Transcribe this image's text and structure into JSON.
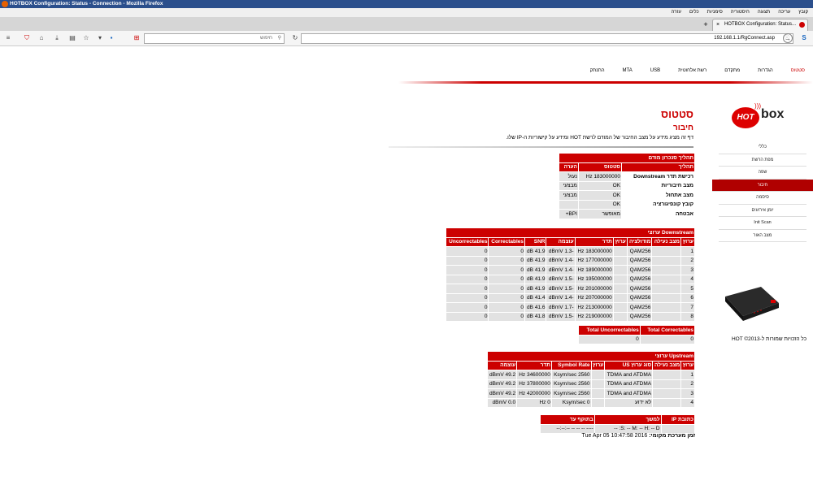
{
  "window": {
    "title": "HOTBOX Configuration: Status - Connection - Mozilla Firefox"
  },
  "menu": [
    "קובץ",
    "עריכה",
    "תצוגה",
    "היסטוריה",
    "סימניות",
    "כלים",
    "עזרה"
  ],
  "tab": {
    "title": "HOTBOX Configuration: Status..."
  },
  "url": "192.168.1.1/RgConnect.asp",
  "search_placeholder": "חיפוש",
  "topnav": [
    "סטטוס",
    "הגדרות",
    "מתקדם",
    "רשת אלחוטית",
    "MTA",
    "USB",
    "התנתק"
  ],
  "sidebar": [
    "כללי",
    "מפת הרשת",
    "שפה",
    "חיבור",
    "סיסמה",
    "יומן אירועים",
    "Init Scan",
    "מצב האור"
  ],
  "heading": "סטטוס",
  "subheading": "חיבור",
  "description": "דף זה מציג מידע על מצב החיבור של המודם לרשת HOT ומידע על קישוריות ה-IP שלו.",
  "startup": {
    "title": "תהליך סנכרון מודם",
    "headers": [
      "תהליך",
      "סטטוס",
      "הערה"
    ],
    "rows": [
      [
        "רכישת תדר Downstream",
        "183000000 Hz",
        "נעול"
      ],
      [
        "מצב חיבוריות",
        "OK",
        "מבצעי"
      ],
      [
        "מצב אתחול",
        "OK",
        "מבצעי"
      ],
      [
        "קובץ קונפיגורציה",
        "OK",
        ""
      ],
      [
        "אבטחה",
        "מאופשר",
        "BPI+"
      ]
    ]
  },
  "downstream": {
    "title": "Downstream ערוצי",
    "headers": [
      "ערוץ",
      "מצב נעילה",
      "מודולציה",
      "ערוץ",
      "תדר",
      "עוצמה",
      "SNR",
      "Correctables",
      "Uncorrectables"
    ],
    "rows": [
      [
        "1",
        "",
        "QAM256",
        "",
        "183000000 Hz",
        "-1.3 dBmV",
        "41.9 dB",
        "0",
        "0"
      ],
      [
        "2",
        "",
        "QAM256",
        "",
        "177000000 Hz",
        "-1.4 dBmV",
        "41.9 dB",
        "0",
        "0"
      ],
      [
        "3",
        "",
        "QAM256",
        "",
        "189000000 Hz",
        "-1.4 dBmV",
        "41.9 dB",
        "0",
        "0"
      ],
      [
        "4",
        "",
        "QAM256",
        "",
        "195000000 Hz",
        "-1.5 dBmV",
        "41.9 dB",
        "0",
        "0"
      ],
      [
        "5",
        "",
        "QAM256",
        "",
        "201000000 Hz",
        "-1.5 dBmV",
        "41.9 dB",
        "0",
        "0"
      ],
      [
        "6",
        "",
        "QAM256",
        "",
        "207000000 Hz",
        "-1.4 dBmV",
        "41.4 dB",
        "0",
        "0"
      ],
      [
        "7",
        "",
        "QAM256",
        "",
        "213000000 Hz",
        "-1.7 dBmV",
        "41.6 dB",
        "0",
        "0"
      ],
      [
        "8",
        "",
        "QAM256",
        "",
        "219000000 Hz",
        "-1.5 dBmV",
        "41.8 dB",
        "0",
        "0"
      ]
    ]
  },
  "totals": {
    "headers": [
      "Total Correctables",
      "Total Uncorrectables"
    ],
    "values": [
      "0",
      "0"
    ]
  },
  "upstream": {
    "title": "Upstream ערוצי",
    "headers": [
      "ערוץ",
      "מצב נעילה",
      "סוג ערוץ US",
      "ערוץ",
      "Symbol Rate",
      "תדר",
      "עוצמה"
    ],
    "rows": [
      [
        "1",
        "",
        "TDMA and ATDMA",
        "",
        "2560 Ksym/sec",
        "34600000 Hz",
        "49.2 dBmV"
      ],
      [
        "2",
        "",
        "TDMA and ATDMA",
        "",
        "2560 Ksym/sec",
        "37800000 Hz",
        "49.2 dBmV"
      ],
      [
        "3",
        "",
        "TDMA and ATDMA",
        "",
        "2560 Ksym/sec",
        "42000000 Hz",
        "49.2 dBmV"
      ],
      [
        "4",
        "",
        "לא ידוע",
        "",
        "0 Ksym/sec",
        "0 Hz",
        "0.0 dBmV"
      ]
    ]
  },
  "ip": {
    "headers": [
      "כתובת IP",
      "למשך",
      "בתוקף עד"
    ],
    "row": [
      "",
      "S: -- M: -- H: -- D: --",
      "---- -- -- -- --:--:--"
    ]
  },
  "localtime": {
    "label": "זמן מערכת מקומי:",
    "value": "Tue Apr 05 10:47:58 2016"
  },
  "copyright": "כל הזכויות שמורות ל-HOT ©2013"
}
